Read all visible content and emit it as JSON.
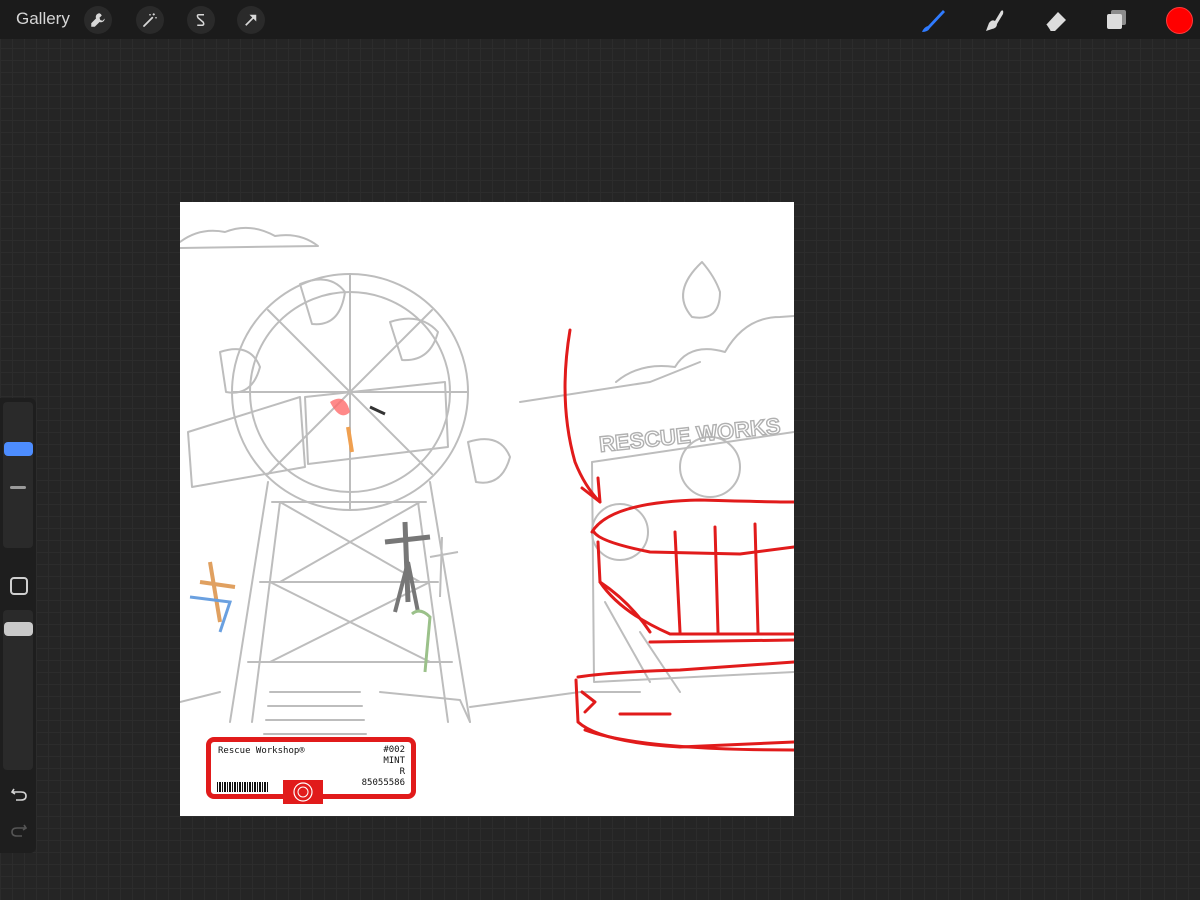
{
  "topbar": {
    "gallery_label": "Gallery",
    "left_tools": [
      {
        "name": "wrench-icon"
      },
      {
        "name": "magic-wand-icon"
      },
      {
        "name": "selection-s-icon"
      },
      {
        "name": "transform-arrow-icon"
      }
    ],
    "right_tools": [
      {
        "name": "brush-icon",
        "active": true
      },
      {
        "name": "smudge-icon"
      },
      {
        "name": "eraser-icon"
      },
      {
        "name": "layers-icon"
      }
    ],
    "current_color": "#ff0000"
  },
  "sidebar": {
    "brush_size_icon": "brush-size-slider",
    "modify_icon": "square-modify-icon",
    "opacity_icon": "opacity-slider",
    "undo_icon": "undo-icon",
    "redo_icon": "redo-icon"
  },
  "canvas": {
    "sign_text": "RESCUE WORKS",
    "sticker": {
      "title": "Rescue Workshop®",
      "number": "#002",
      "grade": "MINT",
      "mark": "R",
      "code": "85055586"
    }
  },
  "colors": {
    "accent": "#2f7bff",
    "sketch_red": "#e11b1b",
    "sketch_gray": "#b8b8b8"
  }
}
